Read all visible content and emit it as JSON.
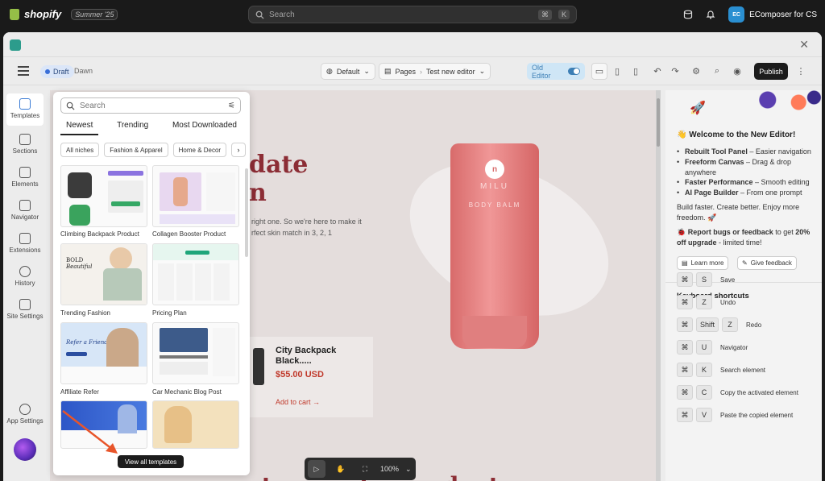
{
  "shopify": {
    "brand": "shopify",
    "season": "Summer '25",
    "search_placeholder": "Search",
    "kbd_cmd": "⌘",
    "kbd_k": "K",
    "store_badge": "EC",
    "store_name": "EComposer for CS"
  },
  "toolbar": {
    "status": "Draft",
    "theme": "Dawn",
    "device_select": "Default",
    "pages_label": "Pages",
    "page_name": "Test new editor",
    "old_editor": "Old Editor",
    "publish": "Publish"
  },
  "rail": [
    {
      "label": "Templates",
      "icon": "templates-icon"
    },
    {
      "label": "Sections",
      "icon": "sections-icon"
    },
    {
      "label": "Elements",
      "icon": "elements-icon"
    },
    {
      "label": "Navigator",
      "icon": "navigator-icon"
    },
    {
      "label": "Extensions",
      "icon": "extensions-icon"
    },
    {
      "label": "History",
      "icon": "history-icon"
    },
    {
      "label": "Site Settings",
      "icon": "site-settings-icon"
    },
    {
      "label": "App Settings",
      "icon": "app-settings-icon"
    }
  ],
  "templates_panel": {
    "search_placeholder": "Search",
    "tabs": [
      "Newest",
      "Trending",
      "Most Downloaded"
    ],
    "chips": [
      "All niches",
      "Fashion & Apparel",
      "Home & Decor"
    ],
    "templates": [
      "Climbing Backpack Product",
      "Collagen Booster Product",
      "Trending Fashion",
      "Pricing Plan",
      "Affiliate Refer",
      "Car Mechanic Blog Post",
      "",
      ""
    ],
    "view_all": "View all templates"
  },
  "canvas": {
    "hero_line1": "date",
    "hero_line2": "n",
    "hero_paragraph_1": "right one. So we're here to make it",
    "hero_paragraph_2": "rfect skin match in 3, 2, 1",
    "bottle_brand": "MILU",
    "bottle_name": "BODY BALM",
    "product_title": "City Backpack Black.....",
    "product_price": "$55.00 USD",
    "add_to_cart": "Add to cart →",
    "bottom_heading": "st cosmetic products",
    "zoom": "100%"
  },
  "right_panel": {
    "welcome_title": "👋 Welcome to the New Editor!",
    "bullets": [
      {
        "bold": "Rebuilt Tool Panel",
        "text": " – Easier navigation"
      },
      {
        "bold": "Freeform Canvas",
        "text": " – Drag & drop anywhere"
      },
      {
        "bold": "Faster Performance",
        "text": " – Smooth editing"
      },
      {
        "bold": "AI Page Builder",
        "text": " – From one prompt"
      }
    ],
    "build_faster": "Build faster. Create better. Enjoy more freedom. 🚀",
    "report_bold": "Report bugs or feedback",
    "report_mid": " to get ",
    "report_bold2": "20% off upgrade",
    "report_tail": " - limited time!",
    "learn_more": "Learn more",
    "give_feedback": "Give feedback",
    "shortcuts_title": "Keyboard shortcuts",
    "shortcuts": [
      {
        "keys": [
          "⌘",
          "S"
        ],
        "label": "Save"
      },
      {
        "keys": [
          "⌘",
          "Z"
        ],
        "label": "Undo"
      },
      {
        "keys": [
          "⌘",
          "Shift",
          "Z"
        ],
        "label": "Redo"
      },
      {
        "keys": [
          "⌘",
          "U"
        ],
        "label": "Navigator"
      },
      {
        "keys": [
          "⌘",
          "K"
        ],
        "label": "Search element"
      },
      {
        "keys": [
          "⌘",
          "C"
        ],
        "label": "Copy the activated element"
      },
      {
        "keys": [
          "⌘",
          "V"
        ],
        "label": "Paste the copied element"
      }
    ]
  },
  "colors": {
    "accent_red": "#8c2d35",
    "annotation_arrow": "#e8552a",
    "draft_blue": "#3a6fd8"
  }
}
